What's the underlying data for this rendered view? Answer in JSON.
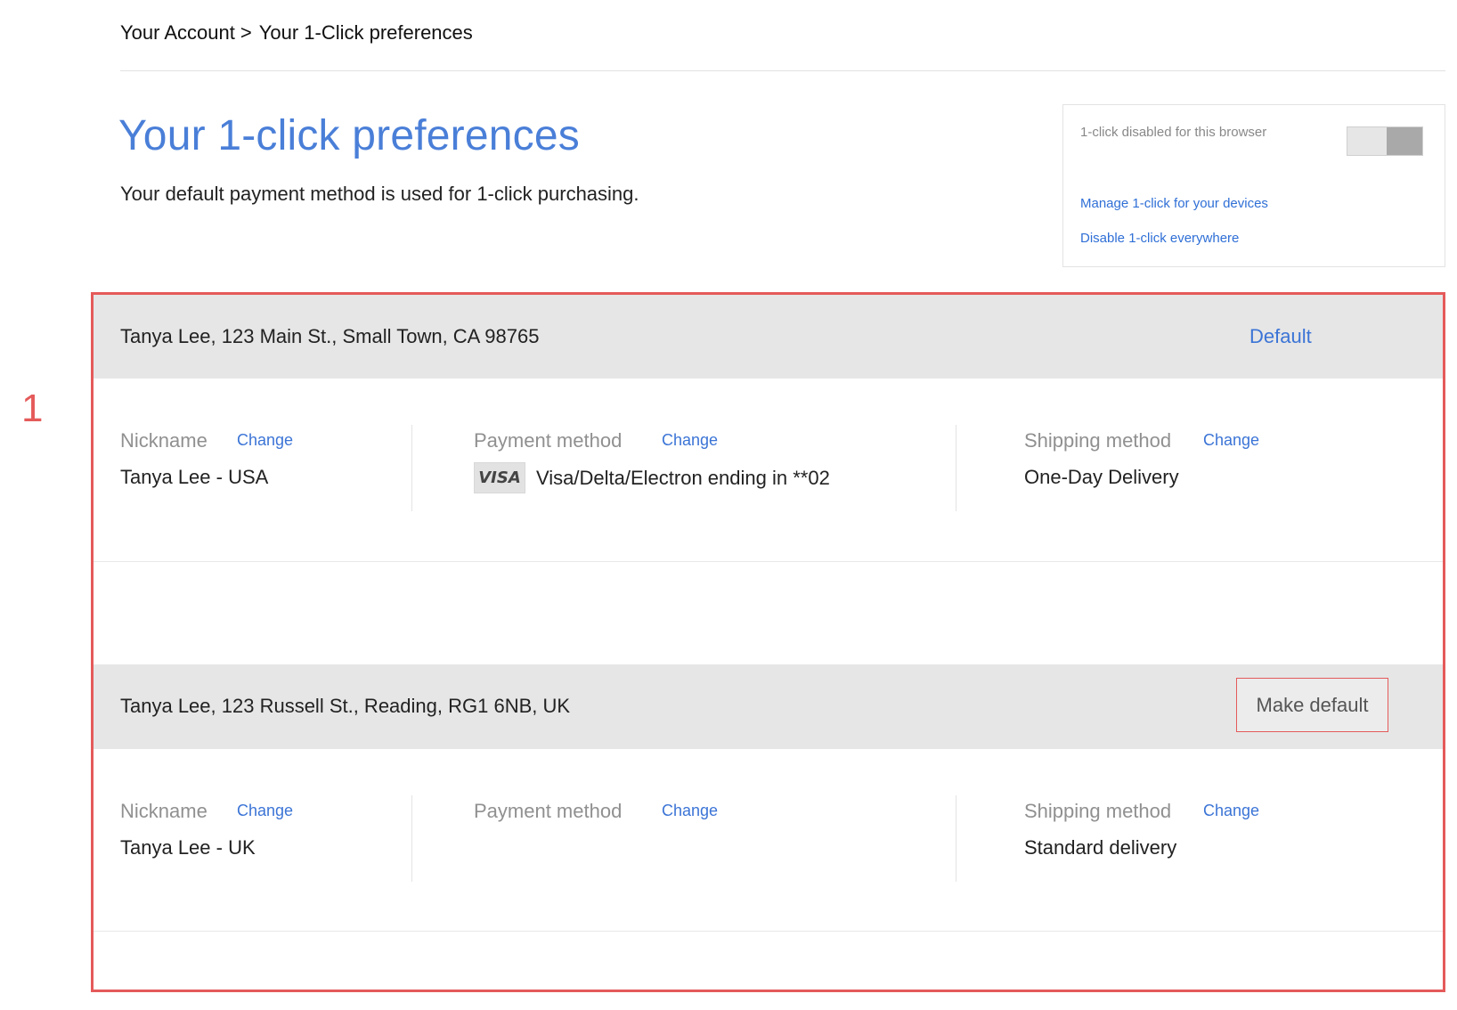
{
  "breadcrumb": {
    "account": "Your Account",
    "separator": ">",
    "current": "Your 1-Click preferences"
  },
  "header": {
    "title": "Your 1-click preferences",
    "subtitle": "Your default payment method is used for 1-click purchasing."
  },
  "browser_settings": {
    "status": "1-click disabled for this browser",
    "toggle_enabled": false,
    "manage_link": "Manage 1-click for your devices",
    "disable_link": "Disable 1-click everywhere"
  },
  "annotation": {
    "number": "1"
  },
  "preferences": [
    {
      "address": "Tanya Lee, 123 Main St., Small Town, CA  98765",
      "default_label": "Default",
      "nickname_label": "Nickname",
      "nickname_change": "Change",
      "nickname": "Tanya Lee - USA",
      "payment_label": "Payment method",
      "payment_change": "Change",
      "card_brand": "VISA",
      "payment": "Visa/Delta/Electron ending in **02",
      "shipping_label": "Shipping method",
      "shipping_change": "Change",
      "shipping": "One-Day Delivery"
    },
    {
      "address": "Tanya Lee, 123 Russell St., Reading, RG1 6NB, UK",
      "make_default_label": "Make default",
      "nickname_label": "Nickname",
      "nickname_change": "Change",
      "nickname": "Tanya Lee - UK",
      "payment_label": "Payment method",
      "payment_change": "Change",
      "shipping_label": "Shipping method",
      "shipping_change": "Change",
      "shipping": "Standard delivery"
    }
  ],
  "colors": {
    "accent": "#4a7fd8",
    "link": "#3b74d6",
    "annotation": "#e55a5a",
    "header_bg": "#e6e6e6"
  }
}
